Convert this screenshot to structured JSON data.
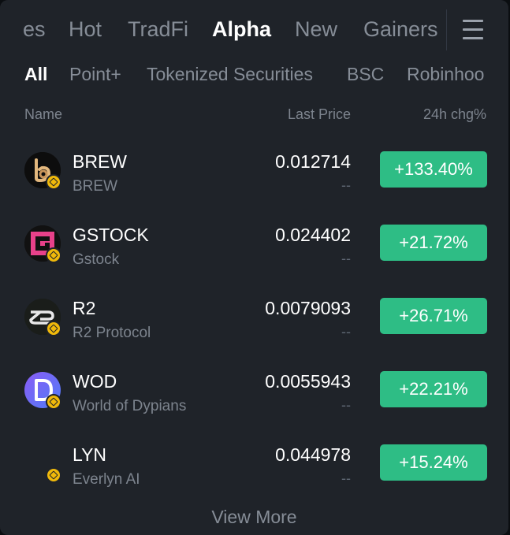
{
  "top_tabs": [
    "es",
    "Hot",
    "TradFi",
    "Alpha",
    "New",
    "Gainers"
  ],
  "top_tabs_active": "Alpha",
  "sub_tabs": [
    "All",
    "Point+",
    "Tokenized Securities",
    "BSC",
    "Robinhoo"
  ],
  "sub_tabs_active": "All",
  "columns": {
    "name": "Name",
    "last_price": "Last Price",
    "change": "24h chg%"
  },
  "rows": [
    {
      "symbol": "BREW",
      "name": "BREW",
      "price": "0.012714",
      "price_sub": "--",
      "change": "+133.40%",
      "icon": "brew-logo-icon"
    },
    {
      "symbol": "GSTOCK",
      "name": "Gstock",
      "price": "0.024402",
      "price_sub": "--",
      "change": "+21.72%",
      "icon": "gstock-logo-icon"
    },
    {
      "symbol": "R2",
      "name": "R2 Protocol",
      "price": "0.0079093",
      "price_sub": "--",
      "change": "+26.71%",
      "icon": "r2-logo-icon"
    },
    {
      "symbol": "WOD",
      "name": "World of Dypians",
      "price": "0.0055943",
      "price_sub": "--",
      "change": "+22.21%",
      "icon": "wod-logo-icon"
    },
    {
      "symbol": "LYN",
      "name": "Everlyn AI",
      "price": "0.044978",
      "price_sub": "--",
      "change": "+15.24%",
      "icon": "lyn-logo-icon"
    }
  ],
  "view_more": "View More",
  "colors": {
    "background": "#1f2329",
    "positive": "#2ebd85",
    "badge": "#f0b90b",
    "text_primary": "#ffffff",
    "text_secondary": "#868d97"
  }
}
